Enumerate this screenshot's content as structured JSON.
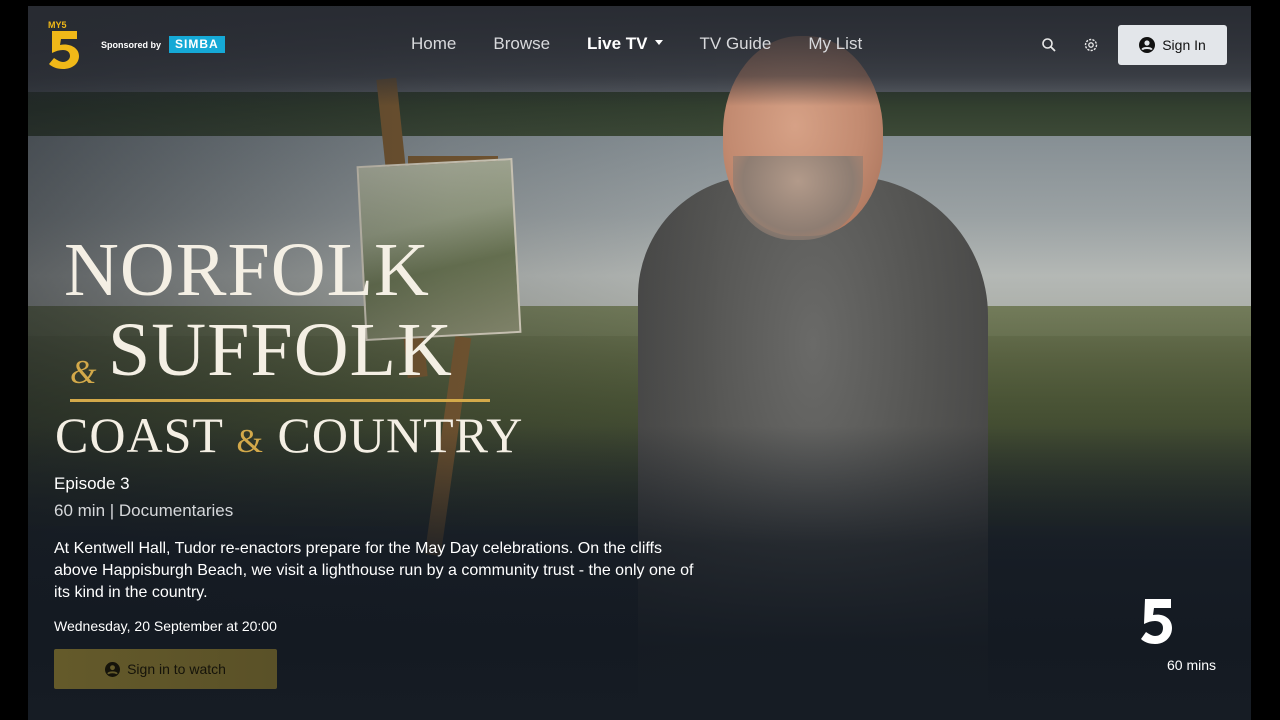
{
  "header": {
    "logo_text": "MY5",
    "sponsor_label": "Sponsored by",
    "sponsor_brand": "SIMBA",
    "nav": [
      {
        "label": "Home"
      },
      {
        "label": "Browse"
      },
      {
        "label": "Live TV"
      },
      {
        "label": "TV Guide"
      },
      {
        "label": "My List"
      }
    ],
    "active_nav": "Live TV",
    "search_icon": "search-icon",
    "settings_icon": "gear-icon",
    "signin_label": "Sign In"
  },
  "title_art": {
    "line1": "NORFOLK",
    "amp": "&",
    "line2": "SUFFOLK",
    "line3a": "COAST",
    "line3b": "COUNTRY"
  },
  "show": {
    "episode": "Episode 3",
    "meta": "60 min | Documentaries",
    "description": "At Kentwell Hall, Tudor re-enactors prepare for the May Day celebrations. On the cliffs above Happisburgh Beach, we visit a lighthouse run by a community trust - the only one of its kind in the country.",
    "air_date": "Wednesday, 20 September at 20:00",
    "watch_label": "Sign in to watch"
  },
  "channel": {
    "logo": "5",
    "duration": "60 mins"
  },
  "colors": {
    "accent_gold": "#d3a94a",
    "simba_blue": "#15a9d6",
    "watch_button": "#645a2a",
    "signin_bg": "#e3e6ea"
  }
}
